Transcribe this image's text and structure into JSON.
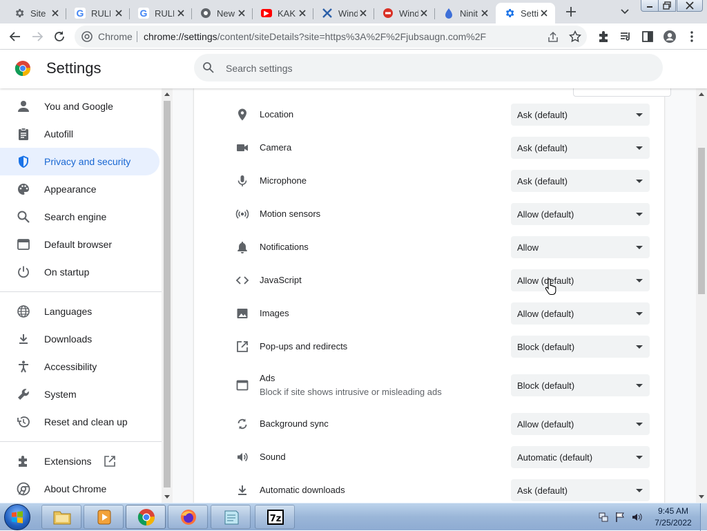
{
  "tabs": [
    {
      "title": "Site",
      "favicon": "gear-icon",
      "color": "#5f6368"
    },
    {
      "title": "RULE",
      "favicon": "google-icon",
      "color": "#4285f4"
    },
    {
      "title": "RULE",
      "favicon": "google-icon",
      "color": "#4285f4"
    },
    {
      "title": "New",
      "favicon": "globe-icon",
      "color": "#5f6368"
    },
    {
      "title": "KAK",
      "favicon": "youtube-icon",
      "color": "#ff0000"
    },
    {
      "title": "Wind",
      "favicon": "x-icon",
      "color": "#2b5fa8"
    },
    {
      "title": "Wind",
      "favicon": "record-icon",
      "color": "#d93025"
    },
    {
      "title": "Ninit",
      "favicon": "ninite-icon",
      "color": "#3d6fd8"
    },
    {
      "title": "Setti",
      "favicon": "gear-icon",
      "color": "#1a73e8",
      "active": true
    }
  ],
  "toolbar": {
    "chip": "Chrome",
    "url_host": "chrome://settings",
    "url_path": "/content/siteDetails?site=https%3A%2F%2Fjubsaugn.com%2F"
  },
  "settings": {
    "title": "Settings",
    "search_placeholder": "Search settings"
  },
  "sidebar": {
    "items": [
      {
        "label": "You and Google",
        "icon": "person-icon"
      },
      {
        "label": "Autofill",
        "icon": "clipboard-icon"
      },
      {
        "label": "Privacy and security",
        "icon": "shield-icon",
        "selected": true
      },
      {
        "label": "Appearance",
        "icon": "palette-icon"
      },
      {
        "label": "Search engine",
        "icon": "search-icon"
      },
      {
        "label": "Default browser",
        "icon": "browser-icon"
      },
      {
        "label": "On startup",
        "icon": "power-icon"
      },
      {
        "label": "Languages",
        "icon": "globe-icon"
      },
      {
        "label": "Downloads",
        "icon": "download-icon"
      },
      {
        "label": "Accessibility",
        "icon": "accessibility-icon"
      },
      {
        "label": "System",
        "icon": "wrench-icon"
      },
      {
        "label": "Reset and clean up",
        "icon": "restore-icon"
      },
      {
        "label": "Extensions",
        "icon": "puzzle-icon"
      },
      {
        "label": "About Chrome",
        "icon": "chrome-icon"
      }
    ]
  },
  "permissions": [
    {
      "label": "Location",
      "value": "Ask (default)",
      "icon": "location-icon"
    },
    {
      "label": "Camera",
      "value": "Ask (default)",
      "icon": "camera-icon"
    },
    {
      "label": "Microphone",
      "value": "Ask (default)",
      "icon": "microphone-icon"
    },
    {
      "label": "Motion sensors",
      "value": "Allow (default)",
      "icon": "sensors-icon"
    },
    {
      "label": "Notifications",
      "value": "Allow",
      "icon": "bell-icon"
    },
    {
      "label": "JavaScript",
      "value": "Allow (default)",
      "icon": "code-icon"
    },
    {
      "label": "Images",
      "value": "Allow (default)",
      "icon": "image-icon"
    },
    {
      "label": "Pop-ups and redirects",
      "value": "Block (default)",
      "icon": "open-in-new-icon"
    },
    {
      "label": "Ads",
      "sublabel": "Block if site shows intrusive or misleading ads",
      "value": "Block (default)",
      "icon": "ads-icon"
    },
    {
      "label": "Background sync",
      "value": "Allow (default)",
      "icon": "sync-icon"
    },
    {
      "label": "Sound",
      "value": "Automatic (default)",
      "icon": "speaker-icon"
    },
    {
      "label": "Automatic downloads",
      "value": "Ask (default)",
      "icon": "download-icon"
    }
  ],
  "taskbar": {
    "apps": [
      "file-explorer-icon",
      "media-player-icon",
      "chrome-icon",
      "firefox-icon",
      "notepad-icon",
      "7zip-icon"
    ],
    "time": "9:45 AM",
    "date": "7/25/2022"
  },
  "colors": {
    "accent": "#1a73e8",
    "selected_bg": "#e8f0fe",
    "selected_text": "#1967d2"
  }
}
